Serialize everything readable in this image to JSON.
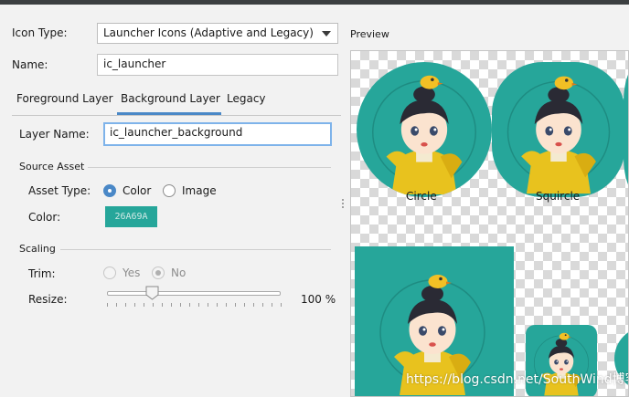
{
  "colors": {
    "accent": "#4A88C7",
    "icon_background": "#26A69A"
  },
  "icon_type": {
    "label": "Icon Type:",
    "value": "Launcher Icons (Adaptive and Legacy)"
  },
  "name": {
    "label": "Name:",
    "value": "ic_launcher"
  },
  "tabs": [
    {
      "label": "Foreground Layer",
      "selected": false
    },
    {
      "label": "Background Layer",
      "selected": true
    },
    {
      "label": "Legacy",
      "selected": false
    }
  ],
  "layer_name": {
    "label": "Layer Name:",
    "value": "ic_launcher_background"
  },
  "source_asset": {
    "title": "Source Asset",
    "asset_type_label": "Asset Type:",
    "options": [
      {
        "label": "Color",
        "selected": true
      },
      {
        "label": "Image",
        "selected": false
      }
    ],
    "color_label": "Color:",
    "color_value": "26A69A"
  },
  "scaling": {
    "title": "Scaling",
    "trim_label": "Trim:",
    "trim_options": [
      {
        "label": "Yes",
        "selected": false
      },
      {
        "label": "No",
        "selected": true
      }
    ],
    "resize_label": "Resize:",
    "resize_value": "100 %",
    "resize_percent": 100
  },
  "preview": {
    "title": "Preview",
    "icons": [
      {
        "caption": "Circle"
      },
      {
        "caption": "Squircle"
      }
    ]
  },
  "watermark": "https://blog.csdn.net/SouthWind博客"
}
